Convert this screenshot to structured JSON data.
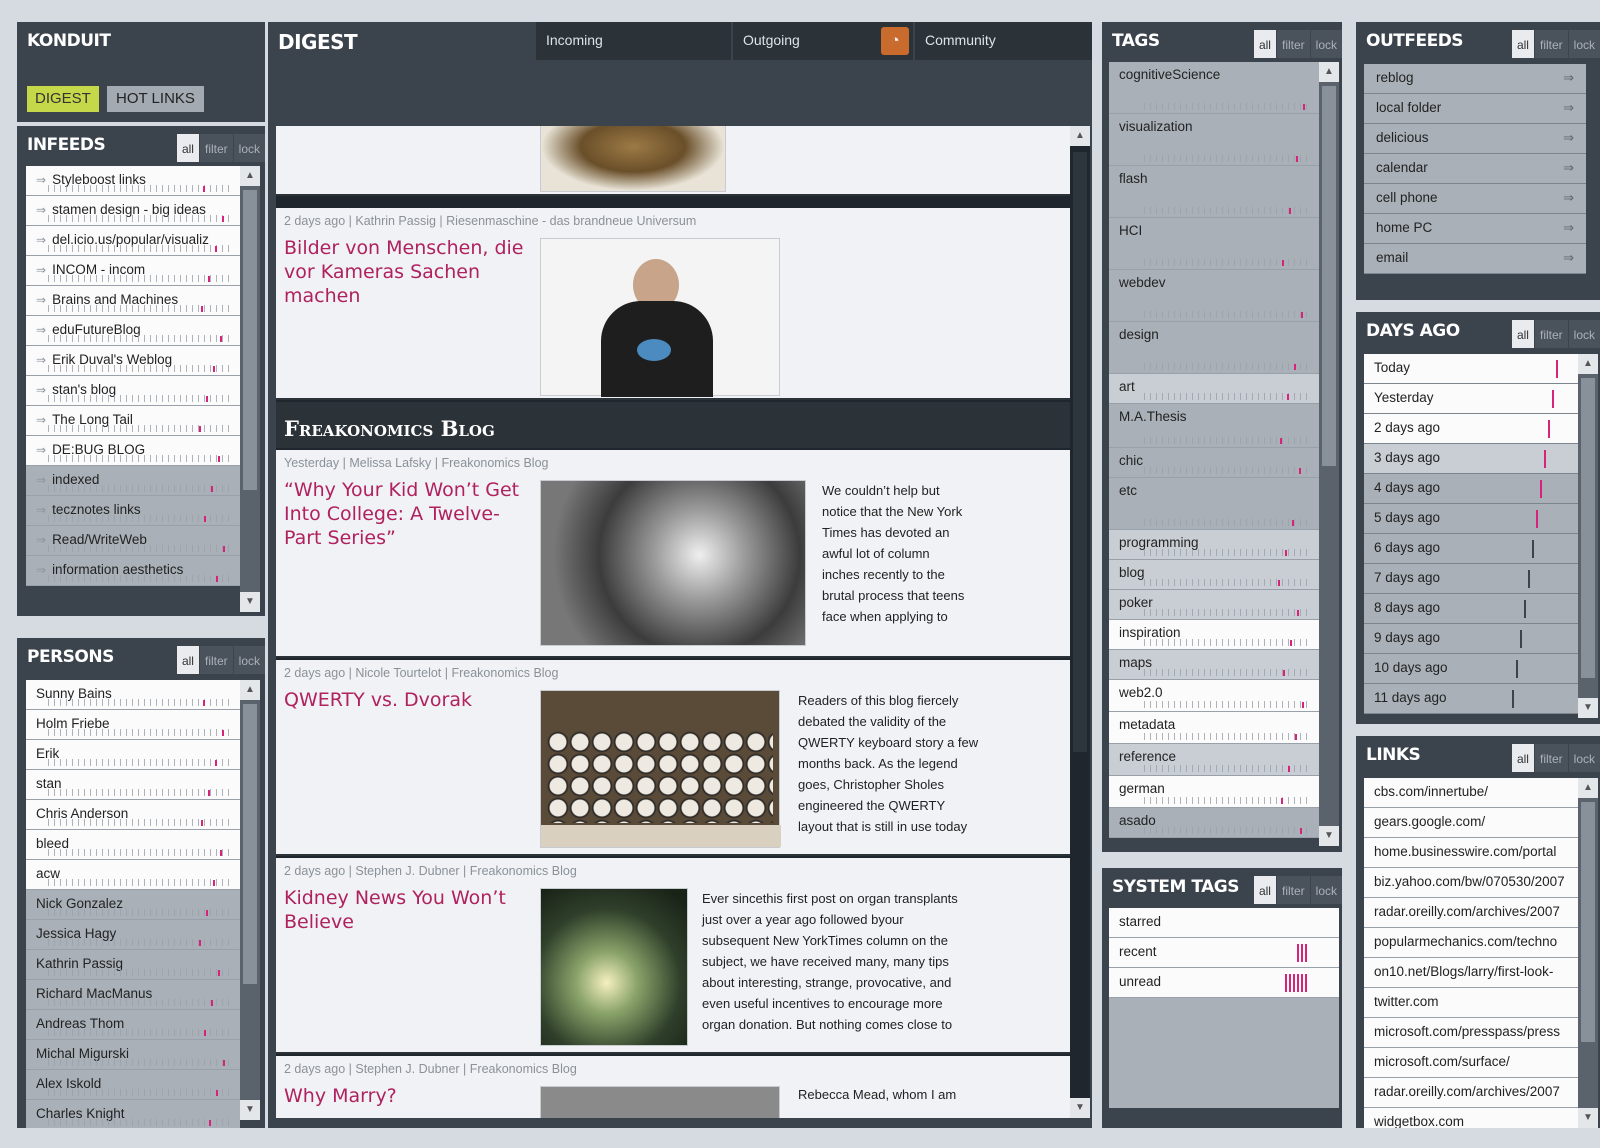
{
  "konduit": {
    "title": "KONDUIT",
    "tabs": [
      "DIGEST",
      "HOT LINKS"
    ]
  },
  "controls": [
    "all",
    "filter",
    "lock"
  ],
  "infeeds": {
    "title": "INFEEDS",
    "items": [
      "Styleboost links",
      "stamen design - big ideas",
      "del.icio.us/popular/visualiz",
      "INCOM - incom",
      "Brains and Machines",
      "eduFutureBlog",
      "Erik Duval's Weblog",
      "stan's blog",
      "The Long Tail",
      "DE:BUG BLOG",
      "indexed",
      "tecznotes links",
      "Read/WriteWeb",
      "information aesthetics"
    ]
  },
  "persons": {
    "title": "PERSONS",
    "items": [
      "Sunny Bains",
      "Holm Friebe",
      "Erik",
      "stan",
      "Chris Anderson",
      "bleed",
      "acw",
      "Nick Gonzalez",
      "Jessica Hagy",
      "Kathrin Passig",
      "Richard MacManus",
      "Andreas Thom",
      "Michal Migurski",
      "Alex Iskold",
      "Charles Knight"
    ]
  },
  "digest": {
    "title": "DIGEST",
    "tabs": [
      "Incoming",
      "Outgoing",
      "Community"
    ],
    "section": "Freakonomics Blog",
    "posts": [
      {
        "meta": "2 days ago | Kathrin Passig | Riesenmaschine - das brandneue Universum",
        "title_lines": [
          "Bilder von Menschen, die",
          "vor Kameras Sachen",
          "machen"
        ]
      },
      {
        "meta": "Yesterday | Melissa Lafsky | Freakonomics Blog",
        "title_lines": [
          "“Why Your Kid Won’t Get",
          "Into College: A Twelve-",
          "Part Series”"
        ],
        "text": [
          "We couldn’t help but",
          "notice that the New York",
          "Times has devoted an",
          "awful lot of column",
          "inches recently to the",
          "brutal process that teens",
          "face when applying to"
        ]
      },
      {
        "meta": "2 days ago | Nicole Tourtelot | Freakonomics Blog",
        "title_lines": [
          "QWERTY vs. Dvorak"
        ],
        "text": [
          "Readers of this blog fiercely",
          "debated the validity of the",
          "QWERTY keyboard story a few",
          "months back. As the legend",
          "goes, Christopher Sholes",
          "engineered the QWERTY",
          "layout that is still in use today"
        ]
      },
      {
        "meta": "2 days ago | Stephen J. Dubner | Freakonomics Blog",
        "title_lines": [
          "Kidney News You Won’t",
          "Believe"
        ],
        "text": [
          "Ever sincethis first post on organ transplants",
          "just over a year ago followed byour",
          "subsequent New YorkTimes column on the",
          "subject, we have received many, many tips",
          "about interesting, strange, provocative, and",
          "even useful incentives to encourage more",
          "organ donation. But nothing comes close to"
        ]
      },
      {
        "meta": "2 days ago | Stephen J. Dubner | Freakonomics Blog",
        "title_lines": [
          "Why Marry?"
        ],
        "text": [
          "Rebecca Mead, whom I am"
        ]
      }
    ]
  },
  "tags": {
    "title": "TAGS",
    "items": [
      "cognitiveScience",
      "visualization",
      "flash",
      "HCI",
      "webdev",
      "design",
      "art",
      "M.A.Thesis",
      "chic",
      "etc",
      "programming",
      "blog",
      "poker",
      "inspiration",
      "maps",
      "web2.0",
      "metadata",
      "reference",
      "german",
      "asado"
    ]
  },
  "system_tags": {
    "title": "SYSTEM TAGS",
    "items": [
      "starred",
      "recent",
      "unread"
    ]
  },
  "outfeeds": {
    "title": "OUTFEEDS",
    "items": [
      "reblog",
      "local folder",
      "delicious",
      "calendar",
      "cell phone",
      "home PC",
      "email"
    ]
  },
  "days_ago": {
    "title": "DAYS AGO",
    "items": [
      "Today",
      "Yesterday",
      "2 days ago",
      "3 days ago",
      "4 days ago",
      "5 days ago",
      "6 days ago",
      "7 days ago",
      "8 days ago",
      "9 days ago",
      "10 days ago",
      "11 days ago"
    ]
  },
  "links": {
    "title": "LINKS",
    "items": [
      "cbs.com/innertube/",
      "gears.google.com/",
      "home.businesswire.com/portal",
      "biz.yahoo.com/bw/070530/2007",
      "radar.oreilly.com/archives/2007",
      "popularmechanics.com/techno",
      "on10.net/Blogs/larry/first-look-",
      "twitter.com",
      "microsoft.com/presspass/press",
      "microsoft.com/surface/",
      "radar.oreilly.com/archives/2007",
      "widgetbox.com"
    ]
  },
  "colors": {
    "accent": "#b0215f",
    "highlight": "#c5d84a",
    "link": "#5b7fb4",
    "spark": "#d6247a"
  }
}
